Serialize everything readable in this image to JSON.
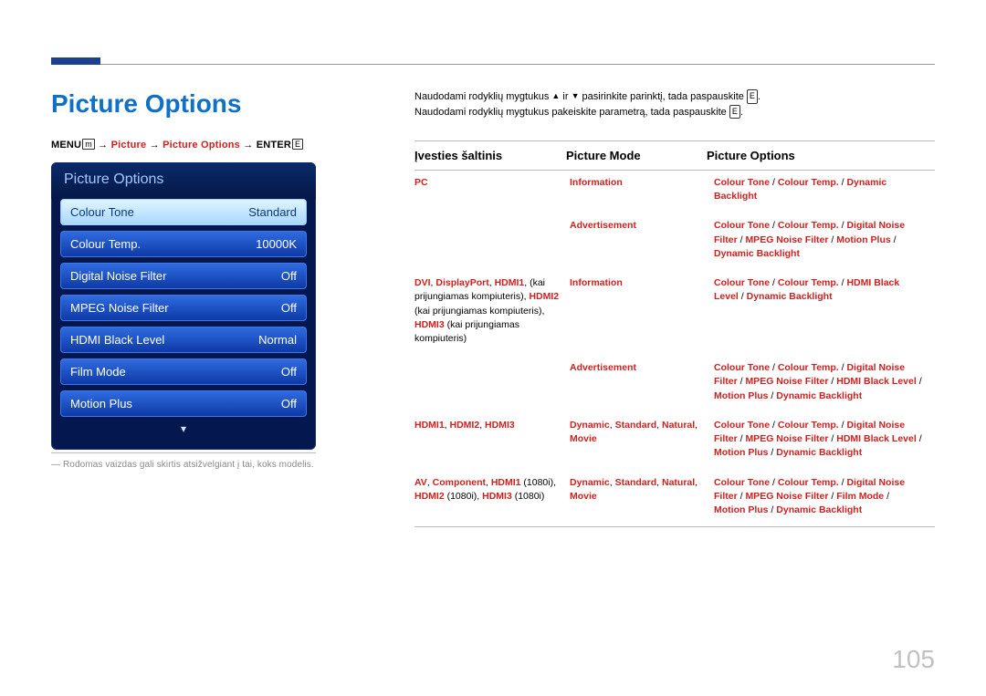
{
  "heading": "Picture Options",
  "path": {
    "menu": "MENU",
    "arrow": " → ",
    "seg1": "Picture",
    "seg2": "Picture Options",
    "enter": "ENTER"
  },
  "osd": {
    "title": "Picture Options",
    "rows": [
      {
        "label": "Colour Tone",
        "value": "Standard",
        "selected": true
      },
      {
        "label": "Colour Temp.",
        "value": "10000K"
      },
      {
        "label": "Digital Noise Filter",
        "value": "Off"
      },
      {
        "label": "MPEG Noise Filter",
        "value": "Off"
      },
      {
        "label": "HDMI Black Level",
        "value": "Normal"
      },
      {
        "label": "Film Mode",
        "value": "Off"
      },
      {
        "label": "Motion Plus",
        "value": "Off"
      }
    ]
  },
  "note": "Rodomas vaizdas gali skirtis atsižvelgiant į tai, koks modelis.",
  "intro": {
    "line1a": "Naudodami rodyklių mygtukus ",
    "line1b": " ir ",
    "line1c": " pasirinkite parinktį, tada paspauskite ",
    "line1d": ".",
    "line2a": "Naudodami rodyklių mygtukus pakeiskite parametrą, tada paspauskite ",
    "line2b": "."
  },
  "table": {
    "headers": [
      "Įvesties šaltinis",
      "Picture Mode",
      "Picture Options"
    ],
    "body": [
      {
        "c1": [
          {
            "r": "PC"
          }
        ],
        "c2": [
          {
            "r": "Information"
          }
        ],
        "c3": [
          {
            "r": "Colour Tone"
          },
          {
            "k": " / "
          },
          {
            "r": "Colour Temp."
          },
          {
            "k": " / "
          },
          {
            "r": "Dynamic Backlight"
          }
        ]
      },
      {
        "c1": [],
        "c2": [
          {
            "r": "Advertisement"
          }
        ],
        "c3": [
          {
            "r": "Colour Tone"
          },
          {
            "k": " / "
          },
          {
            "r": "Colour Temp."
          },
          {
            "k": " / "
          },
          {
            "r": "Digital Noise Filter"
          },
          {
            "k": " / "
          },
          {
            "r": "MPEG Noise Filter"
          },
          {
            "k": " / "
          },
          {
            "r": "Motion Plus"
          },
          {
            "k": " / "
          },
          {
            "r": "Dynamic Backlight"
          }
        ]
      },
      {
        "c1": [
          {
            "r": "DVI"
          },
          {
            "k": ", "
          },
          {
            "r": "DisplayPort"
          },
          {
            "k": ", "
          },
          {
            "r": "HDMI1"
          },
          {
            "k": ", (kai prijungiamas kompiuteris), "
          },
          {
            "r": "HDMI2"
          },
          {
            "k": " (kai prijungiamas kompiuteris), "
          },
          {
            "r": "HDMI3"
          },
          {
            "k": " (kai prijungiamas kompiuteris)"
          }
        ],
        "c2": [
          {
            "r": "Information"
          }
        ],
        "c3": [
          {
            "r": "Colour Tone"
          },
          {
            "k": " / "
          },
          {
            "r": "Colour Temp."
          },
          {
            "k": " / "
          },
          {
            "r": "HDMI Black Level"
          },
          {
            "k": " / "
          },
          {
            "r": "Dynamic Backlight"
          }
        ]
      },
      {
        "c1": [],
        "c2": [
          {
            "r": "Advertisement"
          }
        ],
        "c3": [
          {
            "r": "Colour Tone"
          },
          {
            "k": " / "
          },
          {
            "r": "Colour Temp."
          },
          {
            "k": " / "
          },
          {
            "r": "Digital Noise Filter"
          },
          {
            "k": " / "
          },
          {
            "r": "MPEG Noise Filter"
          },
          {
            "k": " / "
          },
          {
            "r": "HDMI Black Level"
          },
          {
            "k": " / "
          },
          {
            "r": "Motion Plus"
          },
          {
            "k": " / "
          },
          {
            "r": "Dynamic Backlight"
          }
        ]
      },
      {
        "c1": [
          {
            "r": "HDMI1"
          },
          {
            "k": ", "
          },
          {
            "r": "HDMI2"
          },
          {
            "k": ", "
          },
          {
            "r": "HDMI3"
          }
        ],
        "c2": [
          {
            "r": "Dynamic"
          },
          {
            "k": ", "
          },
          {
            "r": "Standard"
          },
          {
            "k": ", "
          },
          {
            "r": "Natural"
          },
          {
            "k": ", "
          },
          {
            "r": "Movie"
          }
        ],
        "c3": [
          {
            "r": "Colour Tone"
          },
          {
            "k": " / "
          },
          {
            "r": "Colour Temp."
          },
          {
            "k": " / "
          },
          {
            "r": "Digital Noise Filter"
          },
          {
            "k": " / "
          },
          {
            "r": "MPEG Noise Filter"
          },
          {
            "k": " / "
          },
          {
            "r": "HDMI Black Level"
          },
          {
            "k": " / "
          },
          {
            "r": "Motion Plus"
          },
          {
            "k": " / "
          },
          {
            "r": "Dynamic Backlight"
          }
        ]
      },
      {
        "c1": [
          {
            "r": "AV"
          },
          {
            "k": ", "
          },
          {
            "r": "Component"
          },
          {
            "k": ", "
          },
          {
            "r": "HDMI1"
          },
          {
            "k": " (1080i), "
          },
          {
            "r": "HDMI2"
          },
          {
            "k": " (1080i), "
          },
          {
            "r": "HDMI3"
          },
          {
            "k": " (1080i)"
          }
        ],
        "c2": [
          {
            "r": "Dynamic"
          },
          {
            "k": ", "
          },
          {
            "r": "Standard"
          },
          {
            "k": ", "
          },
          {
            "r": "Natural"
          },
          {
            "k": ", "
          },
          {
            "r": "Movie"
          }
        ],
        "c3": [
          {
            "r": "Colour Tone"
          },
          {
            "k": " / "
          },
          {
            "r": "Colour Temp."
          },
          {
            "k": " / "
          },
          {
            "r": "Digital Noise Filter"
          },
          {
            "k": " / "
          },
          {
            "r": "MPEG Noise Filter"
          },
          {
            "k": " / "
          },
          {
            "r": "Film Mode"
          },
          {
            "k": " / "
          },
          {
            "r": "Motion Plus"
          },
          {
            "k": " / "
          },
          {
            "r": "Dynamic Backlight"
          }
        ]
      }
    ]
  },
  "pageno": "105"
}
